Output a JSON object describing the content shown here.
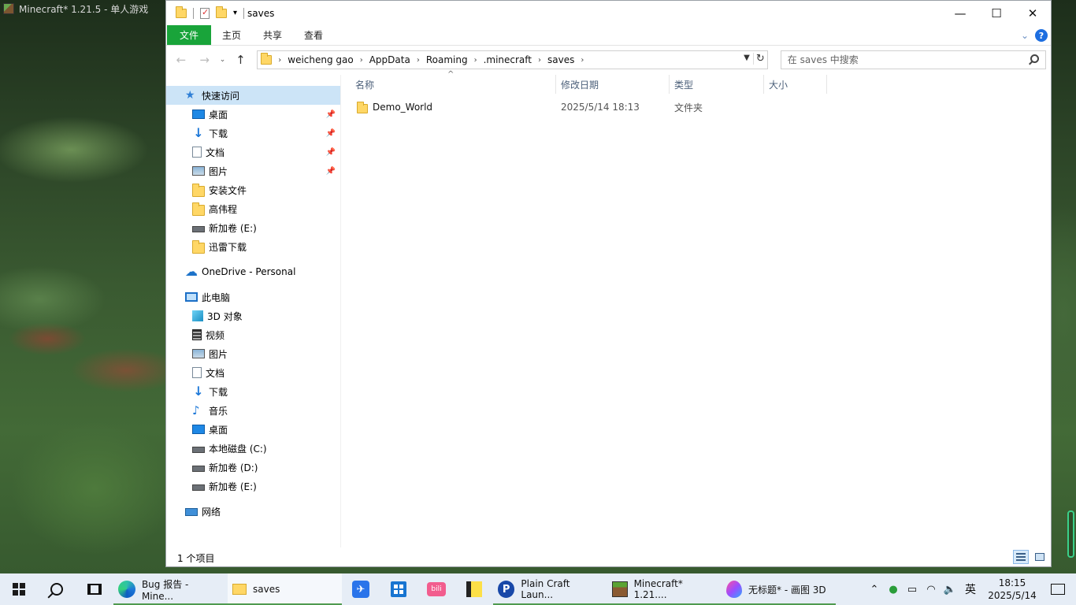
{
  "minecraft_window": {
    "title": "Minecraft* 1.21.5 - 单人游戏"
  },
  "explorer": {
    "title": "saves",
    "window_controls": {
      "minimize": "—",
      "maximize": "☐",
      "close": "✕"
    },
    "ribbon_tabs": [
      "文件",
      "主页",
      "共享",
      "查看"
    ],
    "breadcrumbs": [
      "weicheng gao",
      "AppData",
      "Roaming",
      ".minecraft",
      "saves"
    ],
    "search": {
      "placeholder": "在 saves 中搜索"
    },
    "nav": {
      "quick_access": "快速访问",
      "quick_items": [
        {
          "label": "桌面",
          "icon": "desktop-icon",
          "pinned": true
        },
        {
          "label": "下载",
          "icon": "download-icon",
          "pinned": true
        },
        {
          "label": "文档",
          "icon": "document-icon",
          "pinned": true
        },
        {
          "label": "图片",
          "icon": "pictures-icon",
          "pinned": true
        },
        {
          "label": "安装文件",
          "icon": "folder-icon",
          "pinned": false
        },
        {
          "label": "高伟程",
          "icon": "folder-icon",
          "pinned": false
        },
        {
          "label": "新加卷 (E:)",
          "icon": "drive-icon",
          "pinned": false
        },
        {
          "label": "迅雷下载",
          "icon": "folder-icon",
          "pinned": false
        }
      ],
      "onedrive": "OneDrive - Personal",
      "this_pc": "此电脑",
      "pc_items": [
        {
          "label": "3D 对象",
          "icon": "3d-objects-icon"
        },
        {
          "label": "视频",
          "icon": "video-icon"
        },
        {
          "label": "图片",
          "icon": "pictures-icon"
        },
        {
          "label": "文档",
          "icon": "document-icon"
        },
        {
          "label": "下载",
          "icon": "download-icon"
        },
        {
          "label": "音乐",
          "icon": "music-icon"
        },
        {
          "label": "桌面",
          "icon": "desktop-icon"
        },
        {
          "label": "本地磁盘 (C:)",
          "icon": "drive-c-icon"
        },
        {
          "label": "新加卷 (D:)",
          "icon": "drive-icon"
        },
        {
          "label": "新加卷 (E:)",
          "icon": "drive-icon"
        }
      ],
      "network": "网络"
    },
    "columns": [
      "名称",
      "修改日期",
      "类型",
      "大小"
    ],
    "files": [
      {
        "name": "Demo_World",
        "modified": "2025/5/14 18:13",
        "type": "文件夹",
        "size": ""
      }
    ],
    "status": "1 个项目"
  },
  "taskbar": {
    "apps": [
      {
        "label": "Bug 报告 - Mine...",
        "icon": "edge-icon"
      },
      {
        "label": "saves",
        "icon": "folder-icon"
      },
      {
        "label": "Plain Craft Laun...",
        "icon": "pcl-icon"
      },
      {
        "label": "Minecraft* 1.21....",
        "icon": "minecraft-icon"
      },
      {
        "label": "无标题* - 画图 3D",
        "icon": "paint3d-icon"
      }
    ],
    "ime": "英",
    "time": "18:15",
    "date": "2025/5/14"
  },
  "colors": {
    "file_tab": "#19a43a",
    "selected_nav": "#cce4f7",
    "taskbar": "#e6edf6",
    "folder": "#ffd766"
  }
}
